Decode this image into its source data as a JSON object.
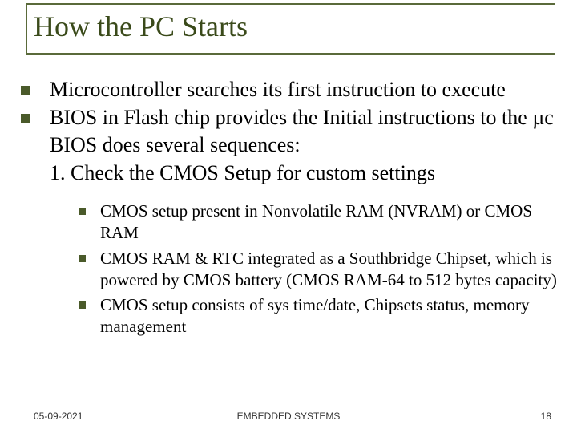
{
  "title": "How the PC Starts",
  "bullets": [
    "Microcontroller searches its first instruction to execute",
    "BIOS in Flash chip provides the Initial instructions to the µc"
  ],
  "continuation": [
    "BIOS does several sequences:",
    "1. Check the CMOS Setup for custom settings"
  ],
  "sub_bullets": [
    "CMOS setup present in Nonvolatile RAM (NVRAM)  or CMOS RAM",
    "CMOS RAM & RTC integrated as a Southbridge Chipset, which is powered by CMOS battery (CMOS RAM-64 to 512 bytes capacity)",
    "CMOS setup consists of sys time/date, Chipsets status, memory management"
  ],
  "footer": {
    "date": "05-09-2021",
    "center": "EMBEDDED SYSTEMS",
    "page": "18"
  }
}
